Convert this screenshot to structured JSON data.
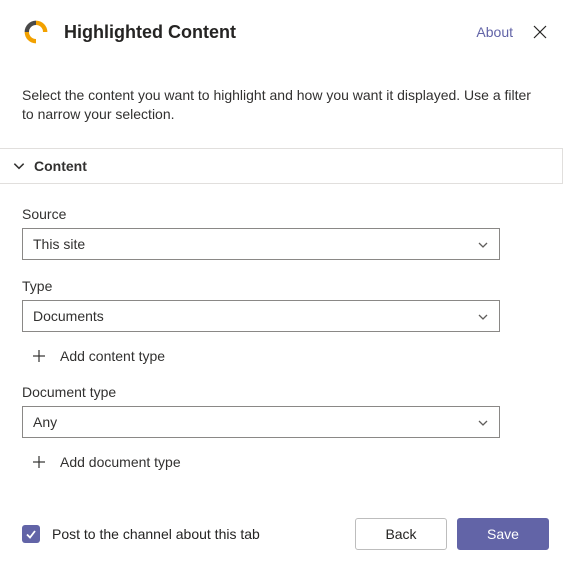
{
  "header": {
    "title": "Highlighted Content",
    "about_label": "About"
  },
  "intro": "Select the content you want to highlight and how you want it displayed. Use a filter to narrow your selection.",
  "section": {
    "title": "Content"
  },
  "fields": {
    "source": {
      "label": "Source",
      "value": "This site"
    },
    "type": {
      "label": "Type",
      "value": "Documents",
      "add_label": "Add content type"
    },
    "document_type": {
      "label": "Document type",
      "value": "Any",
      "add_label": "Add document type"
    }
  },
  "footer": {
    "checkbox_label": "Post to the channel about this tab",
    "checked": true,
    "back_label": "Back",
    "save_label": "Save"
  }
}
